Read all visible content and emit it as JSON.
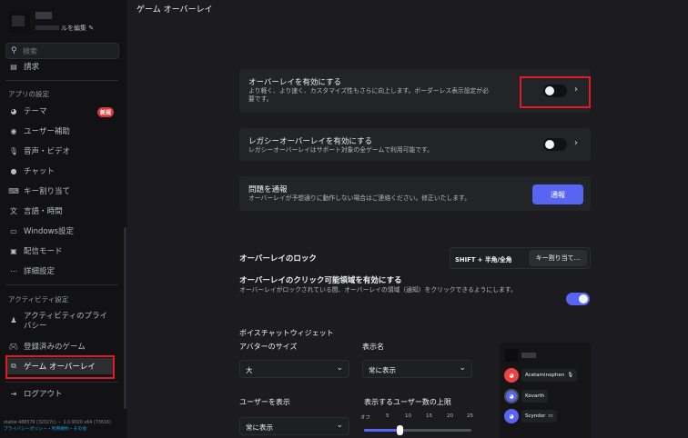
{
  "sidebar": {
    "edit_profile_label": "ルを編集",
    "search_placeholder": "検索",
    "partial_item": "請求",
    "section_app": "アプリの設定",
    "app_items": [
      {
        "label": "テーマ",
        "icon": "palette-icon"
      },
      {
        "label": "ユーザー補助",
        "icon": "accessibility-icon"
      },
      {
        "label": "音声・ビデオ",
        "icon": "microphone-icon"
      },
      {
        "label": "チャット",
        "icon": "chat-bubble-icon"
      },
      {
        "label": "キー割り当て",
        "icon": "keyboard-icon"
      },
      {
        "label": "言語・時間",
        "icon": "language-icon"
      },
      {
        "label": "Windows設定",
        "icon": "windows-icon"
      },
      {
        "label": "配信モード",
        "icon": "stream-icon"
      },
      {
        "label": "詳細設定",
        "icon": "more-icon"
      }
    ],
    "new_badge": "新規",
    "section_activity": "アクティビティ設定",
    "activity_items": [
      {
        "label": "アクティビティのプライバシー",
        "icon": "privacy-icon"
      },
      {
        "label": "登録済みのゲーム",
        "icon": "gamepad-icon"
      },
      {
        "label": "ゲーム オーバーレイ",
        "icon": "overlay-icon"
      }
    ],
    "logout_label": "ログアウト",
    "footer_version": "stable 488579 (32027c) ・ 1.0.9020 x64 (73616)",
    "footer_links": "プライバシーポリシー・利用規約・その他"
  },
  "main": {
    "page_title": "ゲーム オーバーレイ",
    "enable_overlay": {
      "title": "オーバーレイを有効にする",
      "desc_line1": "より軽く、より速く、カスタマイズ性もさらに向上します。ボーダーレス表示設定が必",
      "desc_line2": "要です。",
      "enabled": false
    },
    "legacy_overlay": {
      "title": "レガシーオーバーレイを有効にする",
      "desc": "レガシーオーバーレイはサポート対象の全ゲームで利用可能です。",
      "enabled": false
    },
    "report": {
      "title": "問題を通報",
      "desc": "オーバーレイが予想通りに動作しない場合はご連絡ください。修正いたします。",
      "button": "通報"
    },
    "lock": {
      "title": "オーバーレイのロック",
      "keybind": "SHIFT + 半角/全角",
      "edit_button": "キー割り当て..."
    },
    "clickable": {
      "title": "オーバーレイのクリック可能領域を有効にする",
      "desc": "オーバーレイがロックされている間、オーバーレイの領域（通知）をクリックできるようにします。",
      "enabled": true
    },
    "voice_widget": {
      "title": "ボイスチャットウィジェット",
      "avatar_size_label": "アバターのサイズ",
      "avatar_size_value": "大",
      "display_name_label": "表示名",
      "display_name_value": "常に表示",
      "show_users_label": "ユーザーを表示",
      "show_users_value": "常に表示",
      "max_users_label": "表示するユーザー数の上限",
      "slider_ticks": [
        "オフ",
        "5",
        "10",
        "15",
        "20",
        "25"
      ],
      "preview_users": [
        "Acetaminophen",
        "Kovarth",
        "Scyndor"
      ]
    }
  },
  "colors": {
    "accent": "#5865f2",
    "highlight_box": "#e01b24",
    "new_badge": "#da373c"
  }
}
